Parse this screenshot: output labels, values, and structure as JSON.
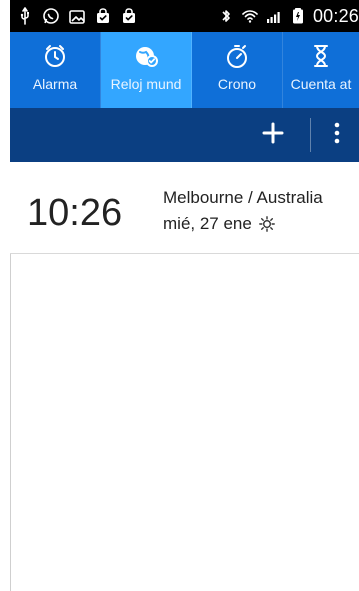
{
  "status_bar": {
    "time": "00:26",
    "left_icons": [
      "usb-icon",
      "whatsapp-icon",
      "image-icon",
      "bag-icon",
      "bag-check-icon"
    ],
    "right_icons": [
      "bluetooth-icon",
      "wifi-icon",
      "signal-icon",
      "battery-icon"
    ]
  },
  "tabs": [
    {
      "label": "Alarma",
      "icon": "alarm-clock-icon",
      "active": false
    },
    {
      "label": "Reloj mund",
      "icon": "world-clock-icon",
      "active": true
    },
    {
      "label": "Crono",
      "icon": "stopwatch-icon",
      "active": false
    },
    {
      "label": "Cuenta at",
      "icon": "hourglass-icon",
      "active": false
    }
  ],
  "action_bar": {
    "add_icon": "plus-icon",
    "more_icon": "more-vert-icon"
  },
  "world_clock": {
    "items": [
      {
        "time": "10:26",
        "city": "Melbourne / Australia",
        "date": "mié, 27 ene",
        "daynight_icon": "sun-icon"
      }
    ]
  },
  "colors": {
    "tab_bar": "#0f6fd8",
    "tab_active": "#33a6ff",
    "action_bar": "#0b3f82",
    "status_bar": "#000000"
  }
}
